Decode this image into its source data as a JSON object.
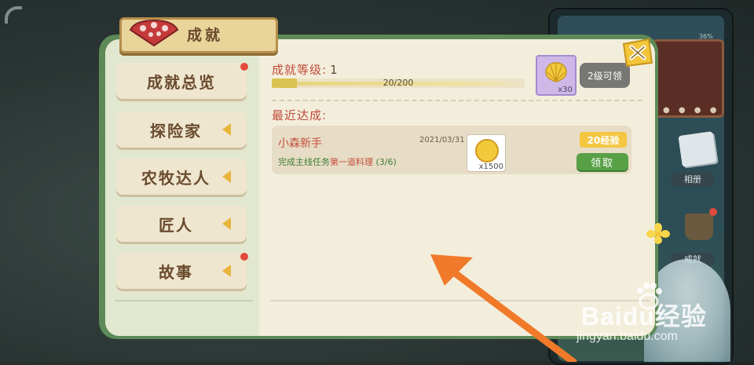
{
  "window": {
    "title": "成就"
  },
  "sidebar": {
    "items": [
      {
        "label": "成就总览",
        "has_arrow": false,
        "has_badge": true
      },
      {
        "label": "探险家",
        "has_arrow": true,
        "has_badge": false
      },
      {
        "label": "农牧达人",
        "has_arrow": true,
        "has_badge": false
      },
      {
        "label": "匠人",
        "has_arrow": true,
        "has_badge": false
      },
      {
        "label": "故事",
        "has_arrow": true,
        "has_badge": true
      }
    ]
  },
  "level": {
    "label": "成就等级:",
    "value": "1",
    "progress_text": "20/200",
    "progress_fraction": 0.1,
    "reward_count": "x30",
    "reward_icon": "shell-icon",
    "next_level_button": "2级可领"
  },
  "recent": {
    "label": "最近达成:",
    "items": [
      {
        "name": "小森新手",
        "date": "2021/03/31",
        "desc_prefix": "完成主线任务",
        "desc_highlight": "第一道料理",
        "desc_suffix": "(3/6)",
        "reward_count": "x1500",
        "reward_icon": "coin-icon",
        "exp_badge": "20经验",
        "claim_button": "领取"
      }
    ]
  },
  "background": {
    "album_label": "相册",
    "achievement_label": "成就",
    "status_text": "36%"
  },
  "watermark": {
    "brand": "Baidu经验",
    "url": "jingyan.baidu.com"
  },
  "colors": {
    "panel_green": "#5d8a57",
    "accent_red": "#c04b3b",
    "claim_green": "#58a046",
    "exp_yellow": "#f4c642",
    "arrow_orange": "#f07a2a"
  }
}
